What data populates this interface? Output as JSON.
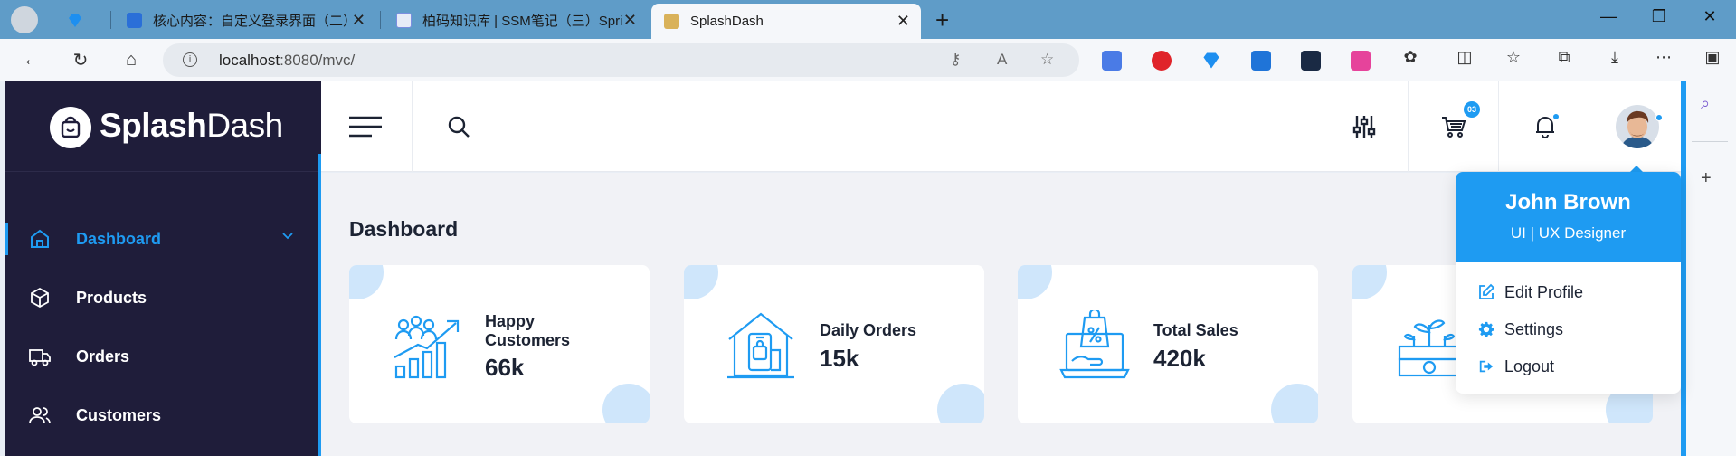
{
  "browser": {
    "tabs": [
      {
        "title": "",
        "favicon": "profile-icon"
      },
      {
        "title": "",
        "favicon": "diamond-icon"
      },
      {
        "title": "核心内容：自定义登录界面（二）",
        "favicon": "doc-icon"
      },
      {
        "title": "柏码知识库 | SSM笔记（三）Spri",
        "favicon": "heart-icon"
      },
      {
        "title": "SplashDash",
        "favicon": "splash-icon"
      }
    ],
    "new_tab_label": "+",
    "url_host": "localhost",
    "url_rest": ":8080/mvc/"
  },
  "app": {
    "logo_bold": "Splash",
    "logo_light": "Dash",
    "nav": [
      {
        "label": "Dashboard",
        "icon": "home-icon"
      },
      {
        "label": "Products",
        "icon": "box-icon"
      },
      {
        "label": "Orders",
        "icon": "truck-icon"
      },
      {
        "label": "Customers",
        "icon": "users-icon"
      }
    ],
    "cart_count": "03",
    "page_title": "Dashboard",
    "cards": [
      {
        "label": "Happy Customers",
        "value": "66k",
        "icon": "customers-growth-icon"
      },
      {
        "label": "Daily Orders",
        "value": "15k",
        "icon": "shop-phone-icon"
      },
      {
        "label": "Total Sales",
        "value": "420k",
        "icon": "laptop-sales-icon"
      },
      {
        "label": "",
        "value": "",
        "icon": "money-plant-icon"
      }
    ],
    "profile": {
      "name": "John Brown",
      "role": "UI | UX Designer",
      "menu": [
        {
          "label": "Edit Profile",
          "icon": "edit-icon"
        },
        {
          "label": "Settings",
          "icon": "gear-icon"
        },
        {
          "label": "Logout",
          "icon": "logout-icon"
        }
      ]
    }
  },
  "colors": {
    "accent": "#1e9bf2",
    "sidebar": "#1f1d3a",
    "tabbar": "#5f9cc8"
  }
}
